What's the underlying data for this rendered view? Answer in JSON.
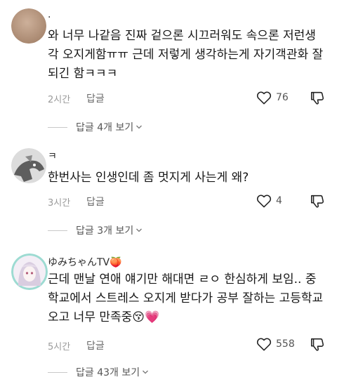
{
  "comments": [
    {
      "author": ".",
      "lines": [
        "와 너무 나같음 진짜 겉으론 시끄러워도 속으론 저런생",
        "각 오지게함ㅠㅠ 근데 저렇게 생각하는게 자기객관화 잘",
        "되긴 함ㅋㅋㅋ"
      ],
      "time": "2시간",
      "reply_label": "답글",
      "likes": "76",
      "replies_label": "답글 4개 보기",
      "avatar_color": "#bfa08a"
    },
    {
      "author": "ㅋ",
      "lines": [
        "한번사는 인생인데 좀 멋지게 사는게 왜?"
      ],
      "time": "3시간",
      "reply_label": "답글",
      "likes": "4",
      "replies_label": "답글 3개 보기",
      "avatar_color": "#d9d9d9"
    },
    {
      "author": "ゆみちゃんTV🍑",
      "lines": [
        "근데 맨날 연애 얘기만 해대면 ㄹㅇ 한심하게 보임.. 중",
        "학교에서 스트레스 오지게 받다가 공부 잘하는 고등학교",
        "오고 너무 만족중😚💗"
      ],
      "time": "5시간",
      "reply_label": "답글",
      "likes": "558",
      "replies_label": "답글 43개 보기",
      "avatar_color": "#bfe8e0"
    }
  ],
  "icons": {
    "like": "heart-outline-icon",
    "dislike": "thumbs-down-outline-icon",
    "expand": "chevron-down-icon"
  }
}
